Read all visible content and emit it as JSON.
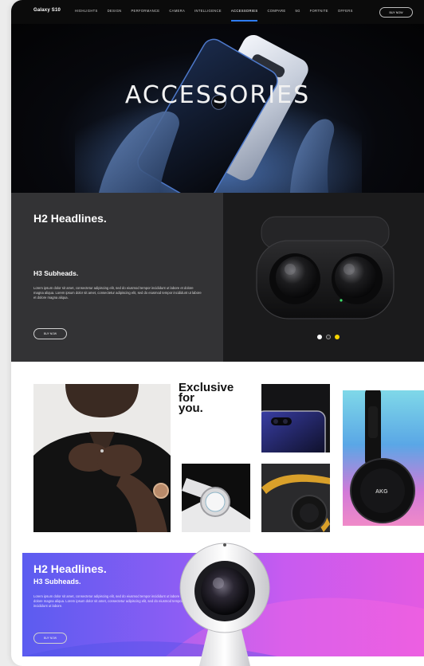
{
  "nav": {
    "brand": "Galaxy S10",
    "items": [
      "HIGHLIGHTS",
      "DESIGN",
      "PERFORMANCE",
      "CAMERA",
      "INTELLIGENCE",
      "ACCESSORIES",
      "COMPARE",
      "5G",
      "FORTNITE",
      "OFFERS"
    ],
    "active_item": "ACCESSORIES",
    "buy_label": "BUY NOW"
  },
  "hero": {
    "title": "ACCESSORIES"
  },
  "section2": {
    "h2": "H2 Headlines.",
    "h3": "H3 Subheads.",
    "body": "Lorem ipsum dolor sit amet, consectetur adipiscing elit, sed do eiusmod tempor incididunt ut labore et dolore magna aliqua. Lorem ipsum dolor sit amet, consectetur adipiscing elit, sed do eiusmod tempor incididunt ut labore et dolore magna aliqua.",
    "button": "BUY NOW",
    "carousel": {
      "count": 3,
      "active_index": 2,
      "colors": [
        "#ffffff",
        "#2a2a2a",
        "#f5d400"
      ]
    }
  },
  "section3": {
    "headline": "Exclusive for you.",
    "headline_lines": [
      "Exclusive",
      "for",
      "you."
    ]
  },
  "banner": {
    "h2": "H2 Headlines.",
    "h3": "H3 Subheads.",
    "body": "Lorem ipsum dolor sit amet, consectetur adipiscing elit, sed do eiusmod tempor incididunt ut labore et dolore magna aliqua. Lorem ipsum dolor sit amet, consectetur adipiscing elit, sed do eiusmod tempor incididunt ut labore.",
    "button": "BUY NOW"
  },
  "colors": {
    "accent": "#2f7cf6",
    "dark_panel": "#333335",
    "banner_start": "#5b5cf0",
    "banner_end": "#e35ae2"
  }
}
